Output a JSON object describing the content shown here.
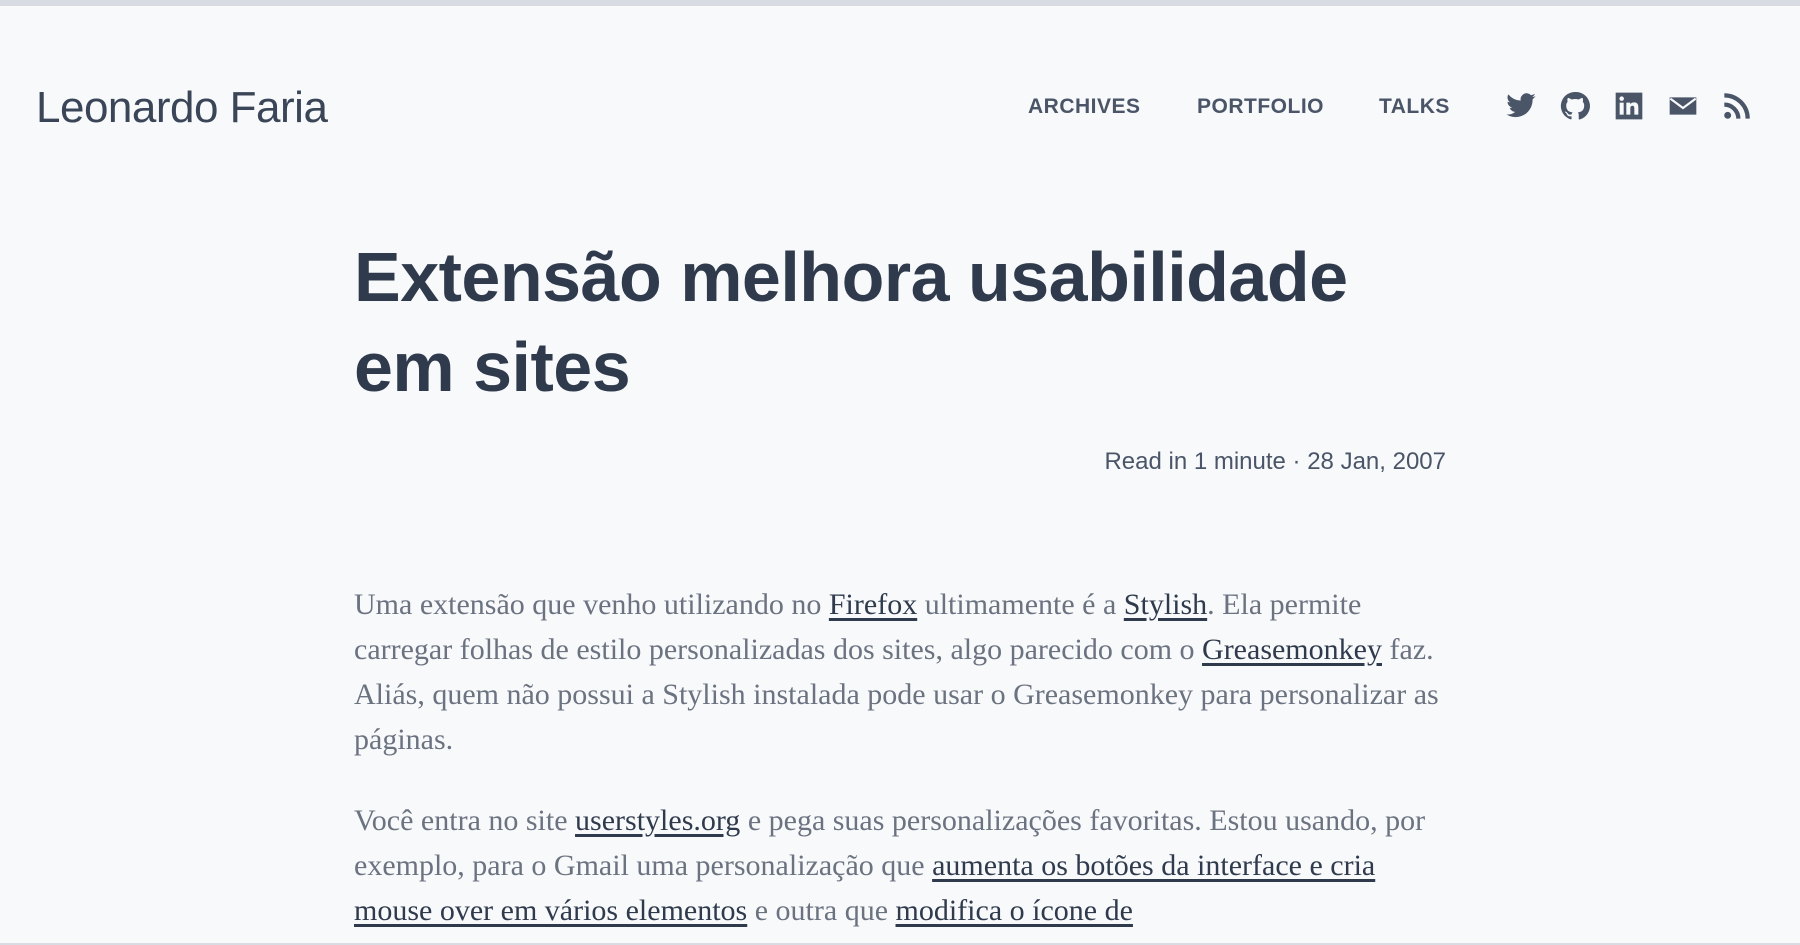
{
  "site": {
    "title": "Leonardo Faria"
  },
  "nav": {
    "items": [
      {
        "label": "ARCHIVES"
      },
      {
        "label": "PORTFOLIO"
      },
      {
        "label": "TALKS"
      }
    ]
  },
  "social": {
    "icons": [
      "twitter-icon",
      "github-icon",
      "linkedin-icon",
      "email-icon",
      "rss-icon"
    ],
    "color": "#4a5568"
  },
  "post": {
    "title": "Extensão melhora usabilidade em sites",
    "meta": "Read in 1 minute · 28 Jan, 2007",
    "p1": {
      "t1": "Uma extensão que venho utilizando no ",
      "l1": "Firefox",
      "t2": " ultimamente é a ",
      "l2": "Stylish",
      "t3": ". Ela permite carregar folhas de estilo personalizadas dos sites, algo parecido com o ",
      "l3": "Greasemonkey",
      "t4": " faz. Aliás, quem não possui a Stylish instalada pode usar o Greasemonkey para personalizar as páginas."
    },
    "p2": {
      "t1": "Você entra no site ",
      "l1": "userstyles.org",
      "t2": " e pega suas personalizações favoritas. Estou usando, por exemplo, para o Gmail uma personalização que ",
      "l2": "aumenta os botões da interface e cria mouse over em vários elementos",
      "t3": " e outra que ",
      "l3": "modifica o ícone de"
    }
  },
  "colors": {
    "background": "#f8f9fb",
    "heading": "#2f3a4c",
    "body_text": "#6b7280"
  }
}
